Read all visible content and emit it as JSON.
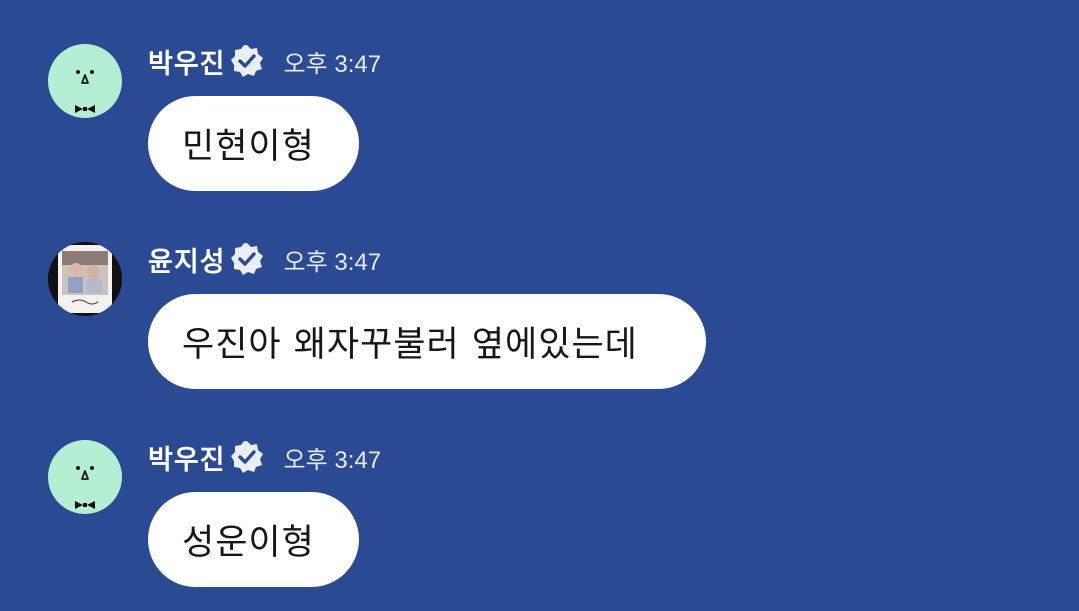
{
  "colors": {
    "background": "#2a4b93",
    "bubble": "#ffffff",
    "avatar_mint": "#b5efd3",
    "badge": "#e9eef9"
  },
  "messages": [
    {
      "sender": "박우진",
      "verified_icon": "verified-badge-icon",
      "time": "오후 3:47",
      "avatar": "mint-face-avatar",
      "text": "민현이형"
    },
    {
      "sender": "윤지성",
      "verified_icon": "verified-badge-icon",
      "time": "오후 3:47",
      "avatar": "photo-avatar",
      "text": "우진아 왜자꾸불러 옆에있는데"
    },
    {
      "sender": "박우진",
      "verified_icon": "verified-badge-icon",
      "time": "오후 3:47",
      "avatar": "mint-face-avatar",
      "text": "성운이형"
    }
  ]
}
